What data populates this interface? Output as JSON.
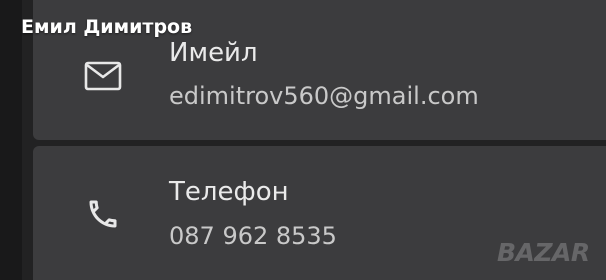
{
  "profile": {
    "name": "Емил Димитров"
  },
  "contact": {
    "email": {
      "label": "Имейл",
      "value": "edimitrov560@gmail.com",
      "icon": "mail-icon"
    },
    "phone": {
      "label": "Телефон",
      "value": "087 962 8535",
      "icon": "phone-icon"
    }
  },
  "watermark": {
    "text": "BAZAR"
  }
}
